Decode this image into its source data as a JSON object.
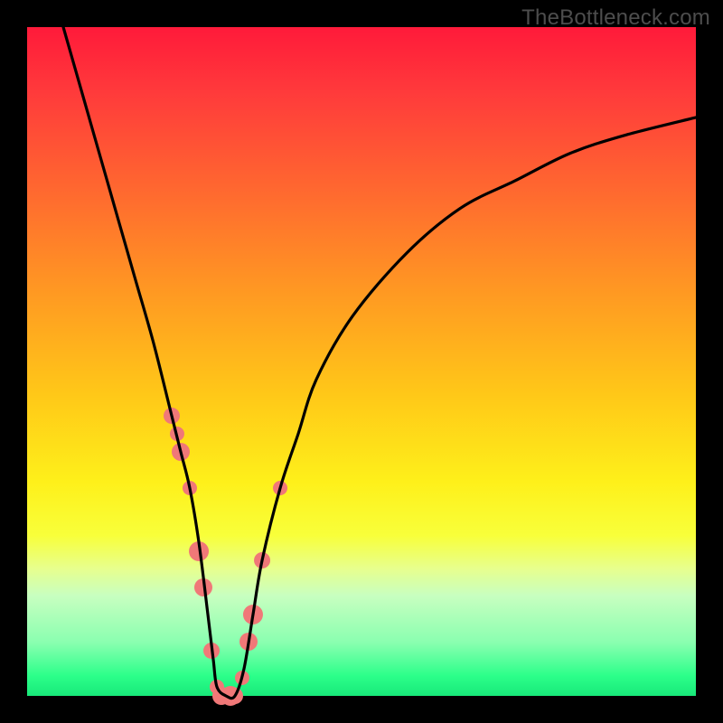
{
  "watermark": "TheBottleneck.com",
  "colors": {
    "frame": "#000000",
    "curve": "#000000",
    "marker_fill": "#f07878",
    "marker_stroke": "#e86a6a"
  },
  "chart_data": {
    "type": "line",
    "title": "",
    "xlabel": "",
    "ylabel": "",
    "xlim": [
      0,
      100
    ],
    "ylim": [
      0,
      100
    ],
    "grid": false,
    "x": [
      5.41,
      8.11,
      10.81,
      13.51,
      16.22,
      18.92,
      21.62,
      22.97,
      24.32,
      25.68,
      27.03,
      27.84,
      28.38,
      29.73,
      31.08,
      32.43,
      33.78,
      35.14,
      37.84,
      40.54,
      43.24,
      48.65,
      56.76,
      64.86,
      72.97,
      81.08,
      89.19,
      100.0
    ],
    "y": [
      100.0,
      90.54,
      81.08,
      71.62,
      62.16,
      52.7,
      41.89,
      36.49,
      31.08,
      22.97,
      12.16,
      5.41,
      1.35,
      0.0,
      0.0,
      4.05,
      12.16,
      20.27,
      31.08,
      39.19,
      47.3,
      56.76,
      66.22,
      72.97,
      77.03,
      81.08,
      83.78,
      86.49
    ],
    "annotations": [],
    "markers": {
      "x": [
        21.62,
        22.43,
        22.97,
        24.32,
        25.68,
        26.35,
        27.57,
        28.38,
        29.05,
        30.41,
        31.08,
        32.16,
        33.11,
        33.78,
        35.14,
        37.84
      ],
      "y": [
        41.89,
        39.19,
        36.49,
        31.08,
        21.62,
        16.22,
        6.76,
        1.35,
        0.0,
        0.0,
        0.0,
        2.7,
        8.11,
        12.16,
        20.27,
        31.08
      ],
      "r": [
        9,
        8,
        10,
        8,
        11,
        10,
        9,
        8,
        10,
        11,
        9,
        8,
        10,
        11,
        9,
        8
      ]
    }
  }
}
